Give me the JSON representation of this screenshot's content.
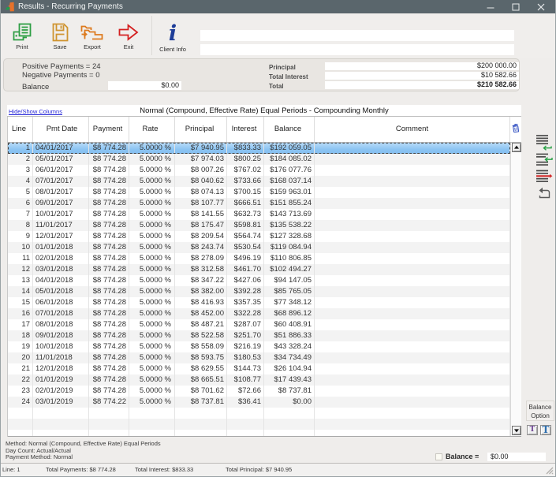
{
  "window": {
    "title": "Results - Recurring Payments",
    "icon": "app-leaf-icon",
    "controls": {
      "minimize": "minimize",
      "maximize": "maximize",
      "close": "close"
    }
  },
  "toolbar": {
    "buttons": [
      {
        "id": "print",
        "label": "Print",
        "icon": "printer-icon"
      },
      {
        "id": "save",
        "label": "Save",
        "icon": "floppy-save-icon"
      },
      {
        "id": "export",
        "label": "Export",
        "icon": "export-folder-icon"
      },
      {
        "id": "exit",
        "label": "Exit",
        "icon": "exit-arrow-icon"
      }
    ],
    "client_info": {
      "word1": "Client",
      "word2": "Info",
      "icon": "info-italic-i-icon"
    },
    "fields": {
      "field1": "",
      "field2": ""
    }
  },
  "summary": {
    "positive_payments": "Positive Payments = 24",
    "negative_payments": "Negative Payments = 0",
    "balance_label": "Balance",
    "balance_value": "$0.00",
    "right_rows": [
      {
        "label": "Principal",
        "value": "$200 000.00"
      },
      {
        "label": "Total Interest",
        "value": "$10 582.66"
      },
      {
        "label": "Total",
        "value": "$210 582.66"
      }
    ]
  },
  "schedule": {
    "hide_show_link": "Hide/Show Columns",
    "caption": "Normal (Compound, Effective Rate) Equal Periods - Compounding Monthly",
    "columns": [
      "Line",
      "Pmt Date",
      "Payment",
      "Rate",
      "Principal",
      "Interest",
      "Balance",
      "Comment"
    ],
    "header_icon": "trash-icon",
    "selected_line": 1,
    "rows": [
      {
        "line": "1",
        "date": "04/01/2017",
        "payment": "$8 774.28",
        "rate": "5.0000 %",
        "principal": "$7 940.95",
        "interest": "$833.33",
        "balance": "$192 059.05",
        "comment": ""
      },
      {
        "line": "2",
        "date": "05/01/2017",
        "payment": "$8 774.28",
        "rate": "5.0000 %",
        "principal": "$7 974.03",
        "interest": "$800.25",
        "balance": "$184 085.02",
        "comment": ""
      },
      {
        "line": "3",
        "date": "06/01/2017",
        "payment": "$8 774.28",
        "rate": "5.0000 %",
        "principal": "$8 007.26",
        "interest": "$767.02",
        "balance": "$176 077.76",
        "comment": ""
      },
      {
        "line": "4",
        "date": "07/01/2017",
        "payment": "$8 774.28",
        "rate": "5.0000 %",
        "principal": "$8 040.62",
        "interest": "$733.66",
        "balance": "$168 037.14",
        "comment": ""
      },
      {
        "line": "5",
        "date": "08/01/2017",
        "payment": "$8 774.28",
        "rate": "5.0000 %",
        "principal": "$8 074.13",
        "interest": "$700.15",
        "balance": "$159 963.01",
        "comment": ""
      },
      {
        "line": "6",
        "date": "09/01/2017",
        "payment": "$8 774.28",
        "rate": "5.0000 %",
        "principal": "$8 107.77",
        "interest": "$666.51",
        "balance": "$151 855.24",
        "comment": ""
      },
      {
        "line": "7",
        "date": "10/01/2017",
        "payment": "$8 774.28",
        "rate": "5.0000 %",
        "principal": "$8 141.55",
        "interest": "$632.73",
        "balance": "$143 713.69",
        "comment": ""
      },
      {
        "line": "8",
        "date": "11/01/2017",
        "payment": "$8 774.28",
        "rate": "5.0000 %",
        "principal": "$8 175.47",
        "interest": "$598.81",
        "balance": "$135 538.22",
        "comment": ""
      },
      {
        "line": "9",
        "date": "12/01/2017",
        "payment": "$8 774.28",
        "rate": "5.0000 %",
        "principal": "$8 209.54",
        "interest": "$564.74",
        "balance": "$127 328.68",
        "comment": ""
      },
      {
        "line": "10",
        "date": "01/01/2018",
        "payment": "$8 774.28",
        "rate": "5.0000 %",
        "principal": "$8 243.74",
        "interest": "$530.54",
        "balance": "$119 084.94",
        "comment": ""
      },
      {
        "line": "11",
        "date": "02/01/2018",
        "payment": "$8 774.28",
        "rate": "5.0000 %",
        "principal": "$8 278.09",
        "interest": "$496.19",
        "balance": "$110 806.85",
        "comment": ""
      },
      {
        "line": "12",
        "date": "03/01/2018",
        "payment": "$8 774.28",
        "rate": "5.0000 %",
        "principal": "$8 312.58",
        "interest": "$461.70",
        "balance": "$102 494.27",
        "comment": ""
      },
      {
        "line": "13",
        "date": "04/01/2018",
        "payment": "$8 774.28",
        "rate": "5.0000 %",
        "principal": "$8 347.22",
        "interest": "$427.06",
        "balance": "$94 147.05",
        "comment": ""
      },
      {
        "line": "14",
        "date": "05/01/2018",
        "payment": "$8 774.28",
        "rate": "5.0000 %",
        "principal": "$8 382.00",
        "interest": "$392.28",
        "balance": "$85 765.05",
        "comment": ""
      },
      {
        "line": "15",
        "date": "06/01/2018",
        "payment": "$8 774.28",
        "rate": "5.0000 %",
        "principal": "$8 416.93",
        "interest": "$357.35",
        "balance": "$77 348.12",
        "comment": ""
      },
      {
        "line": "16",
        "date": "07/01/2018",
        "payment": "$8 774.28",
        "rate": "5.0000 %",
        "principal": "$8 452.00",
        "interest": "$322.28",
        "balance": "$68 896.12",
        "comment": ""
      },
      {
        "line": "17",
        "date": "08/01/2018",
        "payment": "$8 774.28",
        "rate": "5.0000 %",
        "principal": "$8 487.21",
        "interest": "$287.07",
        "balance": "$60 408.91",
        "comment": ""
      },
      {
        "line": "18",
        "date": "09/01/2018",
        "payment": "$8 774.28",
        "rate": "5.0000 %",
        "principal": "$8 522.58",
        "interest": "$251.70",
        "balance": "$51 886.33",
        "comment": ""
      },
      {
        "line": "19",
        "date": "10/01/2018",
        "payment": "$8 774.28",
        "rate": "5.0000 %",
        "principal": "$8 558.09",
        "interest": "$216.19",
        "balance": "$43 328.24",
        "comment": ""
      },
      {
        "line": "20",
        "date": "11/01/2018",
        "payment": "$8 774.28",
        "rate": "5.0000 %",
        "principal": "$8 593.75",
        "interest": "$180.53",
        "balance": "$34 734.49",
        "comment": ""
      },
      {
        "line": "21",
        "date": "12/01/2018",
        "payment": "$8 774.28",
        "rate": "5.0000 %",
        "principal": "$8 629.55",
        "interest": "$144.73",
        "balance": "$26 104.94",
        "comment": ""
      },
      {
        "line": "22",
        "date": "01/01/2019",
        "payment": "$8 774.28",
        "rate": "5.0000 %",
        "principal": "$8 665.51",
        "interest": "$108.77",
        "balance": "$17 439.43",
        "comment": ""
      },
      {
        "line": "23",
        "date": "02/01/2019",
        "payment": "$8 774.28",
        "rate": "5.0000 %",
        "principal": "$8 701.62",
        "interest": "$72.66",
        "balance": "$8 737.81",
        "comment": ""
      },
      {
        "line": "24",
        "date": "03/01/2019",
        "payment": "$8 774.22",
        "rate": "5.0000 %",
        "principal": "$8 737.81",
        "interest": "$36.41",
        "balance": "$0.00",
        "comment": ""
      }
    ]
  },
  "side_panel": {
    "icons": [
      "expand-lines-icon",
      "insert-line-icon",
      "delete-line-icon",
      "undo-icon"
    ],
    "balance_option": {
      "line1": "Balance",
      "line2": "Option"
    },
    "t_small": "T",
    "t_large": "T"
  },
  "footer": {
    "method": "Method: Normal (Compound, Effective Rate) Equal Periods",
    "day_count": "Day Count: Actual/Actual",
    "payment_method": "Payment Method: Normal",
    "balance_label": "Balance =",
    "balance_value": "$0.00"
  },
  "status_bar": {
    "line": "Line: 1",
    "total_payments": "Total Payments: $8 774.28",
    "total_interest": "Total Interest: $833.33",
    "total_principal": "Total Principal: $7 940.95"
  },
  "colors": {
    "titlebar": "#5a666c",
    "panel_bg": "#efedeb",
    "summary_bg": "#e9e6e2",
    "selection_blue": "#8cc4f2",
    "link_blue": "#2727d8",
    "print_green": "#2e9e44",
    "save_amber": "#cf9430",
    "export_orange": "#dd7a1e",
    "exit_red": "#d42020",
    "info_navy": "#1e3d98",
    "trash_blue": "#3a57c4",
    "delete_red": "#d22b2b"
  }
}
